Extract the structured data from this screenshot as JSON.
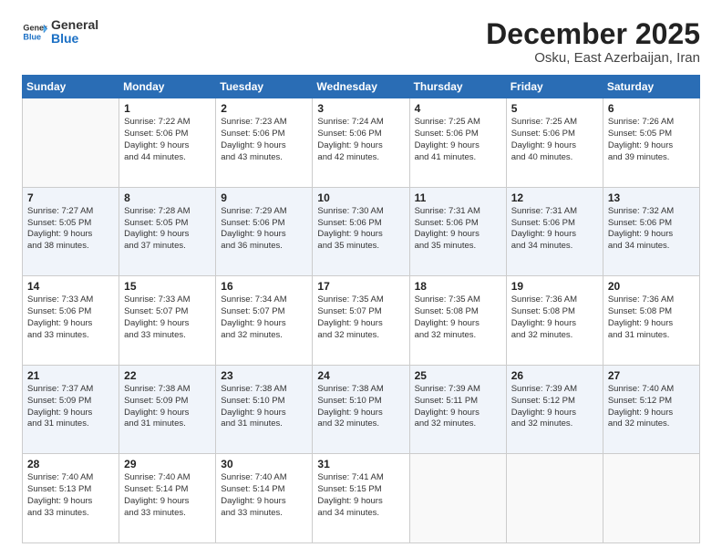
{
  "header": {
    "logo_general": "General",
    "logo_blue": "Blue",
    "month_year": "December 2025",
    "location": "Osku, East Azerbaijan, Iran"
  },
  "weekdays": [
    "Sunday",
    "Monday",
    "Tuesday",
    "Wednesday",
    "Thursday",
    "Friday",
    "Saturday"
  ],
  "weeks": [
    [
      {
        "day": "",
        "info": ""
      },
      {
        "day": "1",
        "info": "Sunrise: 7:22 AM\nSunset: 5:06 PM\nDaylight: 9 hours\nand 44 minutes."
      },
      {
        "day": "2",
        "info": "Sunrise: 7:23 AM\nSunset: 5:06 PM\nDaylight: 9 hours\nand 43 minutes."
      },
      {
        "day": "3",
        "info": "Sunrise: 7:24 AM\nSunset: 5:06 PM\nDaylight: 9 hours\nand 42 minutes."
      },
      {
        "day": "4",
        "info": "Sunrise: 7:25 AM\nSunset: 5:06 PM\nDaylight: 9 hours\nand 41 minutes."
      },
      {
        "day": "5",
        "info": "Sunrise: 7:25 AM\nSunset: 5:06 PM\nDaylight: 9 hours\nand 40 minutes."
      },
      {
        "day": "6",
        "info": "Sunrise: 7:26 AM\nSunset: 5:05 PM\nDaylight: 9 hours\nand 39 minutes."
      }
    ],
    [
      {
        "day": "7",
        "info": "Sunrise: 7:27 AM\nSunset: 5:05 PM\nDaylight: 9 hours\nand 38 minutes."
      },
      {
        "day": "8",
        "info": "Sunrise: 7:28 AM\nSunset: 5:05 PM\nDaylight: 9 hours\nand 37 minutes."
      },
      {
        "day": "9",
        "info": "Sunrise: 7:29 AM\nSunset: 5:06 PM\nDaylight: 9 hours\nand 36 minutes."
      },
      {
        "day": "10",
        "info": "Sunrise: 7:30 AM\nSunset: 5:06 PM\nDaylight: 9 hours\nand 35 minutes."
      },
      {
        "day": "11",
        "info": "Sunrise: 7:31 AM\nSunset: 5:06 PM\nDaylight: 9 hours\nand 35 minutes."
      },
      {
        "day": "12",
        "info": "Sunrise: 7:31 AM\nSunset: 5:06 PM\nDaylight: 9 hours\nand 34 minutes."
      },
      {
        "day": "13",
        "info": "Sunrise: 7:32 AM\nSunset: 5:06 PM\nDaylight: 9 hours\nand 34 minutes."
      }
    ],
    [
      {
        "day": "14",
        "info": "Sunrise: 7:33 AM\nSunset: 5:06 PM\nDaylight: 9 hours\nand 33 minutes."
      },
      {
        "day": "15",
        "info": "Sunrise: 7:33 AM\nSunset: 5:07 PM\nDaylight: 9 hours\nand 33 minutes."
      },
      {
        "day": "16",
        "info": "Sunrise: 7:34 AM\nSunset: 5:07 PM\nDaylight: 9 hours\nand 32 minutes."
      },
      {
        "day": "17",
        "info": "Sunrise: 7:35 AM\nSunset: 5:07 PM\nDaylight: 9 hours\nand 32 minutes."
      },
      {
        "day": "18",
        "info": "Sunrise: 7:35 AM\nSunset: 5:08 PM\nDaylight: 9 hours\nand 32 minutes."
      },
      {
        "day": "19",
        "info": "Sunrise: 7:36 AM\nSunset: 5:08 PM\nDaylight: 9 hours\nand 32 minutes."
      },
      {
        "day": "20",
        "info": "Sunrise: 7:36 AM\nSunset: 5:08 PM\nDaylight: 9 hours\nand 31 minutes."
      }
    ],
    [
      {
        "day": "21",
        "info": "Sunrise: 7:37 AM\nSunset: 5:09 PM\nDaylight: 9 hours\nand 31 minutes."
      },
      {
        "day": "22",
        "info": "Sunrise: 7:38 AM\nSunset: 5:09 PM\nDaylight: 9 hours\nand 31 minutes."
      },
      {
        "day": "23",
        "info": "Sunrise: 7:38 AM\nSunset: 5:10 PM\nDaylight: 9 hours\nand 31 minutes."
      },
      {
        "day": "24",
        "info": "Sunrise: 7:38 AM\nSunset: 5:10 PM\nDaylight: 9 hours\nand 32 minutes."
      },
      {
        "day": "25",
        "info": "Sunrise: 7:39 AM\nSunset: 5:11 PM\nDaylight: 9 hours\nand 32 minutes."
      },
      {
        "day": "26",
        "info": "Sunrise: 7:39 AM\nSunset: 5:12 PM\nDaylight: 9 hours\nand 32 minutes."
      },
      {
        "day": "27",
        "info": "Sunrise: 7:40 AM\nSunset: 5:12 PM\nDaylight: 9 hours\nand 32 minutes."
      }
    ],
    [
      {
        "day": "28",
        "info": "Sunrise: 7:40 AM\nSunset: 5:13 PM\nDaylight: 9 hours\nand 33 minutes."
      },
      {
        "day": "29",
        "info": "Sunrise: 7:40 AM\nSunset: 5:14 PM\nDaylight: 9 hours\nand 33 minutes."
      },
      {
        "day": "30",
        "info": "Sunrise: 7:40 AM\nSunset: 5:14 PM\nDaylight: 9 hours\nand 33 minutes."
      },
      {
        "day": "31",
        "info": "Sunrise: 7:41 AM\nSunset: 5:15 PM\nDaylight: 9 hours\nand 34 minutes."
      },
      {
        "day": "",
        "info": ""
      },
      {
        "day": "",
        "info": ""
      },
      {
        "day": "",
        "info": ""
      }
    ]
  ]
}
